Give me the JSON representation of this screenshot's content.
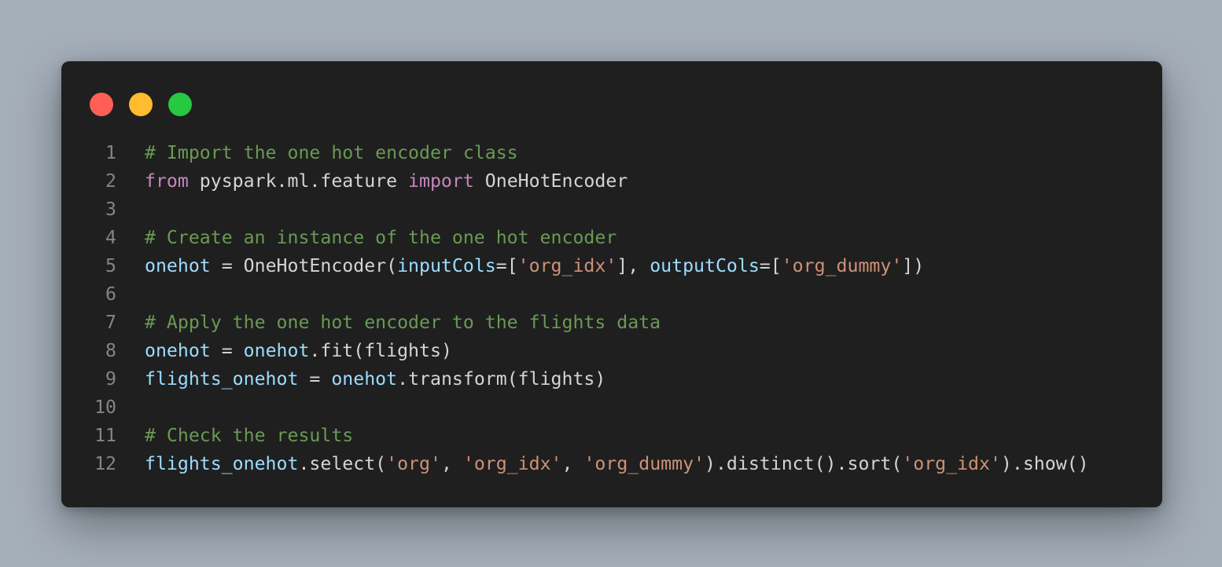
{
  "window": {
    "controls": [
      {
        "name": "close-button",
        "icon": "red-circle",
        "color": "#ff5f57"
      },
      {
        "name": "minimize-button",
        "icon": "yellow-circle",
        "color": "#febc2e"
      },
      {
        "name": "maximize-button",
        "icon": "green-circle",
        "color": "#28c840"
      }
    ]
  },
  "colors": {
    "background": "#a5afba",
    "editor_background": "#1f1f1f",
    "line_number": "#858585",
    "comment": "#6a9955",
    "keyword": "#c586c0",
    "variable": "#9cdcfe",
    "string": "#ce9178",
    "plain": "#d4d4d4"
  },
  "code": {
    "language": "python",
    "lines": [
      {
        "number": "1",
        "tokens": [
          {
            "type": "comment",
            "text": "# Import the one hot encoder class"
          }
        ]
      },
      {
        "number": "2",
        "tokens": [
          {
            "type": "keyword",
            "text": "from"
          },
          {
            "type": "plain",
            "text": " pyspark.ml.feature "
          },
          {
            "type": "keyword",
            "text": "import"
          },
          {
            "type": "plain",
            "text": " OneHotEncoder"
          }
        ]
      },
      {
        "number": "3",
        "tokens": []
      },
      {
        "number": "4",
        "tokens": [
          {
            "type": "comment",
            "text": "# Create an instance of the one hot encoder"
          }
        ]
      },
      {
        "number": "5",
        "tokens": [
          {
            "type": "var",
            "text": "onehot"
          },
          {
            "type": "plain",
            "text": " = OneHotEncoder("
          },
          {
            "type": "var",
            "text": "inputCols"
          },
          {
            "type": "plain",
            "text": "=["
          },
          {
            "type": "string",
            "text": "'org_idx'"
          },
          {
            "type": "plain",
            "text": "], "
          },
          {
            "type": "var",
            "text": "outputCols"
          },
          {
            "type": "plain",
            "text": "=["
          },
          {
            "type": "string",
            "text": "'org_dummy'"
          },
          {
            "type": "plain",
            "text": "])"
          }
        ]
      },
      {
        "number": "6",
        "tokens": []
      },
      {
        "number": "7",
        "tokens": [
          {
            "type": "comment",
            "text": "# Apply the one hot encoder to the flights data"
          }
        ]
      },
      {
        "number": "8",
        "tokens": [
          {
            "type": "var",
            "text": "onehot"
          },
          {
            "type": "plain",
            "text": " = "
          },
          {
            "type": "var",
            "text": "onehot"
          },
          {
            "type": "plain",
            "text": ".fit(flights)"
          }
        ]
      },
      {
        "number": "9",
        "tokens": [
          {
            "type": "var",
            "text": "flights_onehot"
          },
          {
            "type": "plain",
            "text": " = "
          },
          {
            "type": "var",
            "text": "onehot"
          },
          {
            "type": "plain",
            "text": ".transform(flights)"
          }
        ]
      },
      {
        "number": "10",
        "tokens": []
      },
      {
        "number": "11",
        "tokens": [
          {
            "type": "comment",
            "text": "# Check the results"
          }
        ]
      },
      {
        "number": "12",
        "tokens": [
          {
            "type": "var",
            "text": "flights_onehot"
          },
          {
            "type": "plain",
            "text": ".select("
          },
          {
            "type": "string",
            "text": "'org'"
          },
          {
            "type": "plain",
            "text": ", "
          },
          {
            "type": "string",
            "text": "'org_idx'"
          },
          {
            "type": "plain",
            "text": ", "
          },
          {
            "type": "string",
            "text": "'org_dummy'"
          },
          {
            "type": "plain",
            "text": ").distinct().sort("
          },
          {
            "type": "string",
            "text": "'org_idx'"
          },
          {
            "type": "plain",
            "text": ").show()"
          }
        ]
      }
    ]
  }
}
